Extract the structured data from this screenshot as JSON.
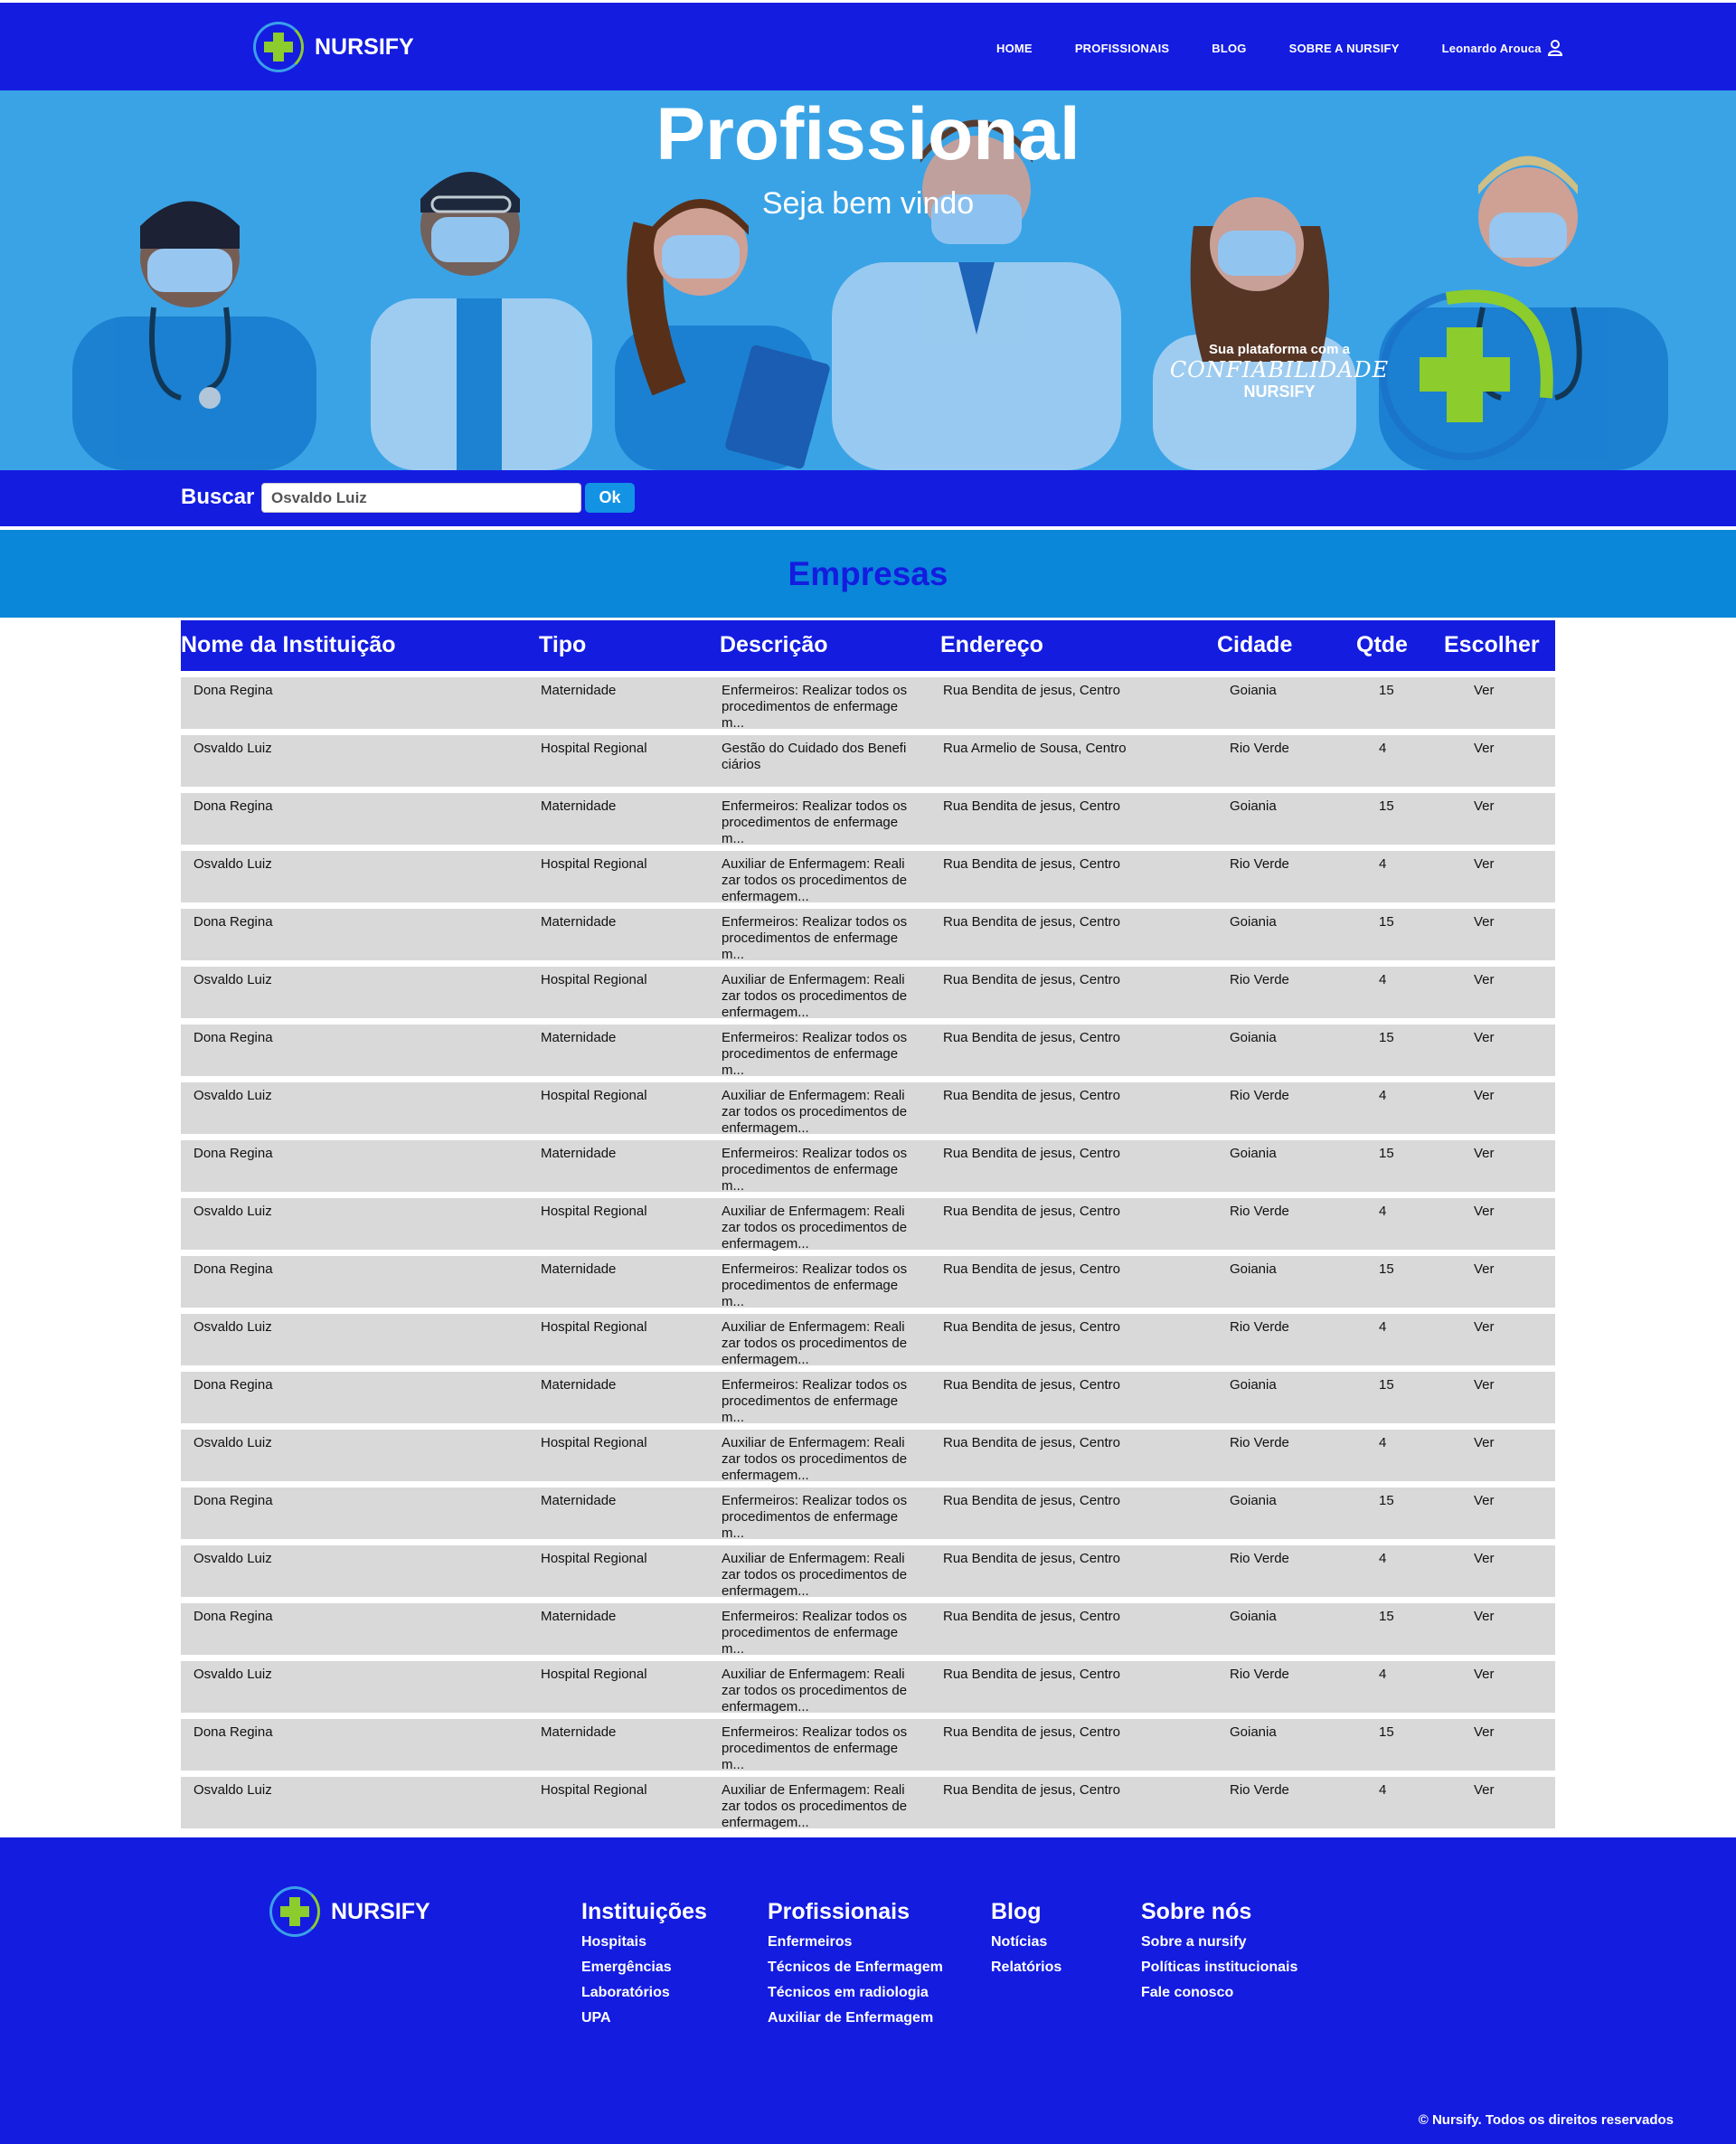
{
  "header": {
    "brand": "NURSIFY",
    "nav": [
      "HOME",
      "PROFISSIONAIS",
      "BLOG",
      "SOBRE A NURSIFY"
    ],
    "user": "Leonardo Arouca"
  },
  "hero": {
    "title": "Profissional",
    "subtitle": "Seja bem vindo",
    "promo_line1": "Sua plataforma com a",
    "promo_line2": "CONFIABILIDADE",
    "promo_line3": "NURSIFY"
  },
  "search": {
    "label": "Buscar",
    "value": "Osvaldo Luiz",
    "button": "Ok"
  },
  "section_title": "Empresas",
  "table": {
    "headers": [
      "Nome da Instituição",
      "Tipo",
      "Descrição",
      "Endereço",
      "Cidade",
      "Qtde",
      "Escolher"
    ],
    "rows": [
      {
        "nome": "Dona Regina",
        "tipo": "Maternidade",
        "descricao": "Enfermeiros: Realizar todos os procedimentos de enfermagem...",
        "endereco": "Rua Bendita  de jesus, Centro",
        "cidade": "Goiania",
        "qtde": "15",
        "acao": "Ver"
      },
      {
        "nome": "Osvaldo Luiz",
        "tipo": "Hospital Regional",
        "descricao": "Gestão do Cuidado dos Beneficiários",
        "endereco": "Rua Armelio de Sousa, Centro",
        "cidade": "Rio Verde",
        "qtde": "4",
        "acao": "Ver"
      },
      {
        "nome": "Dona Regina",
        "tipo": "Maternidade",
        "descricao": "Enfermeiros: Realizar todos os procedimentos de enfermagem...",
        "endereco": "Rua Bendita  de jesus, Centro",
        "cidade": "Goiania",
        "qtde": "15",
        "acao": "Ver"
      },
      {
        "nome": "Osvaldo Luiz",
        "tipo": "Hospital Regional",
        "descricao": "Auxiliar de Enfermagem: Realizar todos os procedimentos de enfermagem...",
        "endereco": "Rua Bendita  de jesus, Centro",
        "cidade": "Rio Verde",
        "qtde": "4",
        "acao": "Ver"
      },
      {
        "nome": "Dona Regina",
        "tipo": "Maternidade",
        "descricao": "Enfermeiros: Realizar todos os procedimentos de enfermagem...",
        "endereco": "Rua Bendita  de jesus, Centro",
        "cidade": "Goiania",
        "qtde": "15",
        "acao": "Ver"
      },
      {
        "nome": "Osvaldo Luiz",
        "tipo": "Hospital Regional",
        "descricao": "Auxiliar de Enfermagem: Realizar todos os procedimentos de enfermagem...",
        "endereco": "Rua Bendita  de jesus, Centro",
        "cidade": "Rio Verde",
        "qtde": "4",
        "acao": "Ver"
      },
      {
        "nome": "Dona Regina",
        "tipo": "Maternidade",
        "descricao": "Enfermeiros: Realizar todos os procedimentos de enfermagem...",
        "endereco": "Rua Bendita  de jesus, Centro",
        "cidade": "Goiania",
        "qtde": "15",
        "acao": "Ver"
      },
      {
        "nome": "Osvaldo Luiz",
        "tipo": "Hospital Regional",
        "descricao": "Auxiliar de Enfermagem: Realizar todos os procedimentos de enfermagem...",
        "endereco": "Rua Bendita  de jesus, Centro",
        "cidade": "Rio Verde",
        "qtde": "4",
        "acao": "Ver"
      },
      {
        "nome": "Dona Regina",
        "tipo": "Maternidade",
        "descricao": "Enfermeiros: Realizar todos os procedimentos de enfermagem...",
        "endereco": "Rua Bendita  de jesus, Centro",
        "cidade": "Goiania",
        "qtde": "15",
        "acao": "Ver"
      },
      {
        "nome": "Osvaldo Luiz",
        "tipo": "Hospital Regional",
        "descricao": "Auxiliar de Enfermagem: Realizar todos os procedimentos de enfermagem...",
        "endereco": "Rua Bendita  de jesus, Centro",
        "cidade": "Rio Verde",
        "qtde": "4",
        "acao": "Ver"
      },
      {
        "nome": "Dona Regina",
        "tipo": "Maternidade",
        "descricao": "Enfermeiros: Realizar todos os procedimentos de enfermagem...",
        "endereco": "Rua Bendita  de jesus, Centro",
        "cidade": "Goiania",
        "qtde": "15",
        "acao": "Ver"
      },
      {
        "nome": "Osvaldo Luiz",
        "tipo": "Hospital Regional",
        "descricao": "Auxiliar de Enfermagem: Realizar todos os procedimentos de enfermagem...",
        "endereco": "Rua Bendita  de jesus, Centro",
        "cidade": "Rio Verde",
        "qtde": "4",
        "acao": "Ver"
      },
      {
        "nome": "Dona Regina",
        "tipo": "Maternidade",
        "descricao": "Enfermeiros: Realizar todos os procedimentos de enfermagem...",
        "endereco": "Rua Bendita  de jesus, Centro",
        "cidade": "Goiania",
        "qtde": "15",
        "acao": "Ver"
      },
      {
        "nome": "Osvaldo Luiz",
        "tipo": "Hospital Regional",
        "descricao": "Auxiliar de Enfermagem: Realizar todos os procedimentos de enfermagem...",
        "endereco": "Rua Bendita  de jesus, Centro",
        "cidade": "Rio Verde",
        "qtde": "4",
        "acao": "Ver"
      },
      {
        "nome": "Dona Regina",
        "tipo": "Maternidade",
        "descricao": "Enfermeiros: Realizar todos os procedimentos de enfermagem...",
        "endereco": "Rua Bendita  de jesus, Centro",
        "cidade": "Goiania",
        "qtde": "15",
        "acao": "Ver"
      },
      {
        "nome": "Osvaldo Luiz",
        "tipo": "Hospital Regional",
        "descricao": "Auxiliar de Enfermagem: Realizar todos os procedimentos de enfermagem...",
        "endereco": "Rua Bendita  de jesus, Centro",
        "cidade": "Rio Verde",
        "qtde": "4",
        "acao": "Ver"
      },
      {
        "nome": "Dona Regina",
        "tipo": "Maternidade",
        "descricao": "Enfermeiros: Realizar todos os procedimentos de enfermagem...",
        "endereco": "Rua Bendita  de jesus, Centro",
        "cidade": "Goiania",
        "qtde": "15",
        "acao": "Ver"
      },
      {
        "nome": "Osvaldo Luiz",
        "tipo": "Hospital Regional",
        "descricao": "Auxiliar de Enfermagem: Realizar todos os procedimentos de enfermagem...",
        "endereco": "Rua Bendita  de jesus, Centro",
        "cidade": "Rio Verde",
        "qtde": "4",
        "acao": "Ver"
      },
      {
        "nome": "Dona Regina",
        "tipo": "Maternidade",
        "descricao": "Enfermeiros: Realizar todos os procedimentos de enfermagem...",
        "endereco": "Rua Bendita  de jesus, Centro",
        "cidade": "Goiania",
        "qtde": "15",
        "acao": "Ver"
      },
      {
        "nome": "Osvaldo Luiz",
        "tipo": "Hospital Regional",
        "descricao": "Auxiliar de Enfermagem: Realizar todos os procedimentos de enfermagem...",
        "endereco": "Rua Bendita  de jesus, Centro",
        "cidade": "Rio Verde",
        "qtde": "4",
        "acao": "Ver"
      }
    ]
  },
  "footer": {
    "brand": "NURSIFY",
    "columns": [
      {
        "title": "Instituições",
        "links": [
          "Hospitais",
          "Emergências",
          "Laboratórios",
          "UPA"
        ]
      },
      {
        "title": "Profissionais",
        "links": [
          "Enfermeiros",
          "Técnicos de Enfermagem",
          "Técnicos em radiologia",
          "Auxiliar de Enfermagem"
        ]
      },
      {
        "title": "Blog",
        "links": [
          "Notícias",
          "Relatórios"
        ]
      },
      {
        "title": "Sobre nós",
        "links": [
          "Sobre a nursify",
          "Políticas institucionais",
          "Fale conosco"
        ]
      }
    ],
    "copyright": "© Nursify. Todos os direitos reservados"
  },
  "colors": {
    "primary": "#141ce0",
    "accent": "#0a87d8",
    "hero_bg": "#3aa3e6",
    "row_bg": "#d9d9d9",
    "brand_green": "#8ccc2c"
  }
}
